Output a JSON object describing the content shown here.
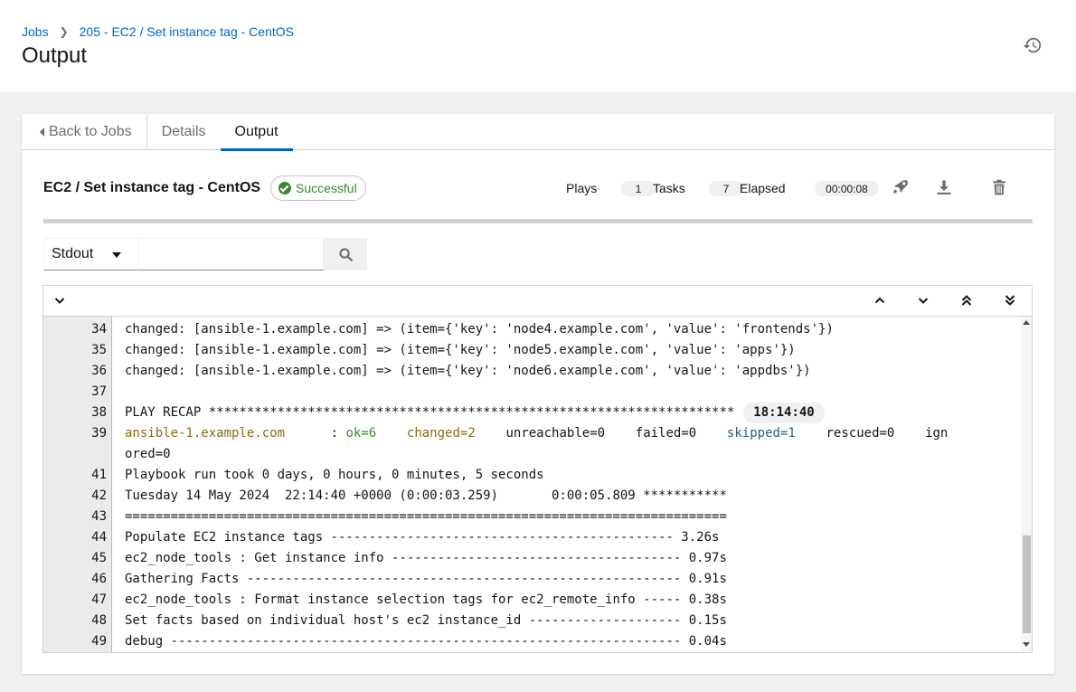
{
  "breadcrumb": {
    "root": "Jobs",
    "current": "205 - EC2 / Set instance tag - CentOS"
  },
  "page": {
    "title": "Output"
  },
  "tabs": [
    {
      "label": "Back to Jobs"
    },
    {
      "label": "Details"
    },
    {
      "label": "Output"
    }
  ],
  "job": {
    "title": "EC2 / Set instance tag - CentOS",
    "status": "Successful",
    "plays_label": "Plays",
    "plays": "1",
    "tasks_label": "Tasks",
    "tasks": "7",
    "elapsed_label": "Elapsed",
    "elapsed": "00:00:08"
  },
  "filter": {
    "selected": "Stdout",
    "placeholder": ""
  },
  "colors": {
    "accent": "#0066cc",
    "success": "#3e8635",
    "changed": "#8b6914",
    "skipped": "#2b5c86"
  },
  "output": {
    "lines": [
      {
        "n": "34",
        "text": "changed: [ansible-1.example.com] => (item={'key': 'node4.example.com', 'value': 'frontends'})"
      },
      {
        "n": "35",
        "text": "changed: [ansible-1.example.com] => (item={'key': 'node5.example.com', 'value': 'apps'})"
      },
      {
        "n": "36",
        "text": "changed: [ansible-1.example.com] => (item={'key': 'node6.example.com', 'value': 'appdbs'})"
      },
      {
        "n": "37",
        "text": ""
      },
      {
        "n": "38",
        "text": "PLAY RECAP *********************************************************************",
        "time": "18:14:40"
      },
      {
        "n": "39",
        "host": "ansible-1.example.com",
        "sep": "      : ",
        "ok": "ok=6",
        "changed": "changed=2",
        "unreachable": "unreachable=0",
        "failed": "failed=0",
        "skipped": "skipped=1",
        "rescued": "rescued=0",
        "ignored1": "ign",
        "ignored2": "ored=0"
      },
      {
        "n": "41",
        "text": "Playbook run took 0 days, 0 hours, 0 minutes, 5 seconds"
      },
      {
        "n": "42",
        "text": "Tuesday 14 May 2024  22:14:40 +0000 (0:00:03.259)       0:00:05.809 ***********"
      },
      {
        "n": "43",
        "text": "==============================================================================="
      },
      {
        "n": "44",
        "text": "Populate EC2 instance tags --------------------------------------------- 3.26s"
      },
      {
        "n": "45",
        "text": "ec2_node_tools : Get instance info -------------------------------------- 0.97s"
      },
      {
        "n": "46",
        "text": "Gathering Facts --------------------------------------------------------- 0.91s"
      },
      {
        "n": "47",
        "text": "ec2_node_tools : Format instance selection tags for ec2_remote_info ----- 0.38s"
      },
      {
        "n": "48",
        "text": "Set facts based on individual host's ec2 instance_id -------------------- 0.15s"
      },
      {
        "n": "49",
        "text": "debug ------------------------------------------------------------------- 0.04s"
      }
    ]
  }
}
